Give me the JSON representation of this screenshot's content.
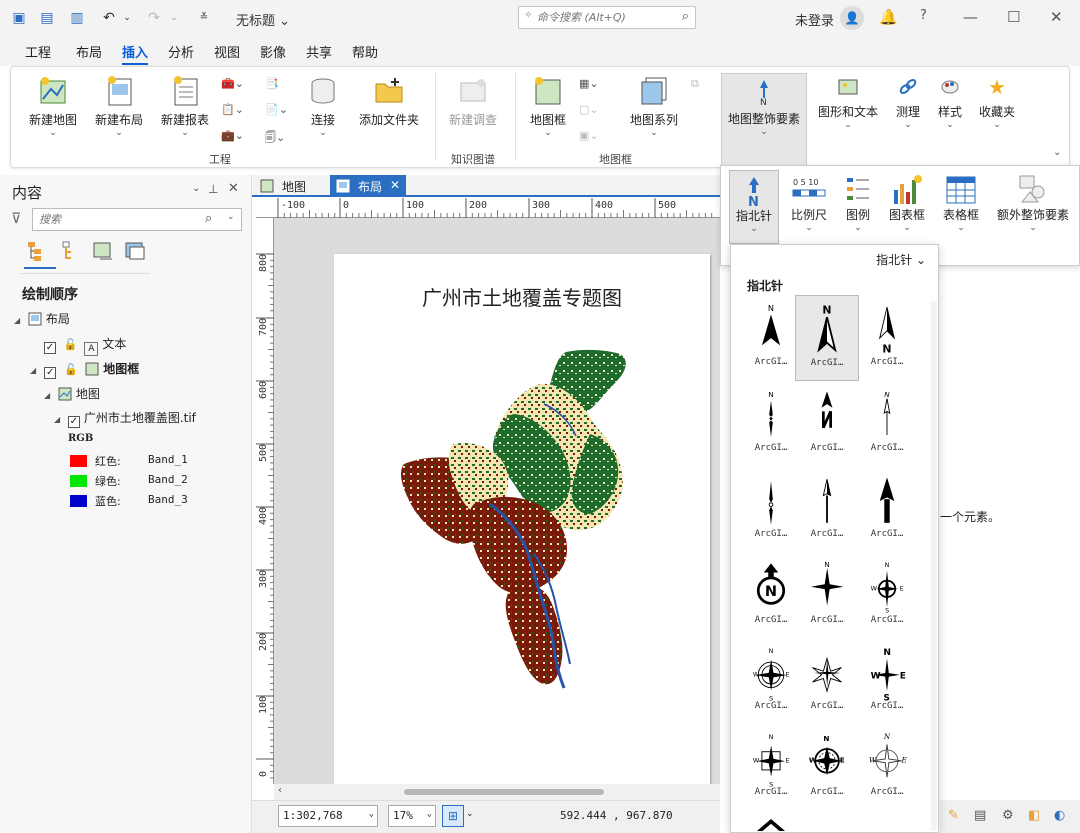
{
  "titlebar": {
    "doc_title": "无标题 ⌄",
    "search_placeholder": "命令搜索 (Alt+Q)",
    "login": "未登录"
  },
  "menu_tabs": [
    "工程",
    "布局",
    "插入",
    "分析",
    "视图",
    "影像",
    "共享",
    "帮助"
  ],
  "active_menu_tab": "插入",
  "ribbon": {
    "buttons": {
      "new_map": "新建地图",
      "new_layout": "新建布局",
      "new_report": "新建报表",
      "connect": "连接",
      "add_folder": "添加文件夹",
      "new_survey": "新建调查",
      "map_frame": "地图框",
      "map_series": "地图系列",
      "decor": "地图整饰要素",
      "graphics_text": "图形和文本",
      "measure": "测理",
      "style": "样式",
      "favorites": "收藏夹"
    },
    "groups": {
      "project": "工程",
      "knowledge": "知识图谱",
      "mapframe": "地图框"
    }
  },
  "contents": {
    "title": "内容",
    "search_placeholder": "搜索",
    "draw_order": "绘制顺序",
    "tree": {
      "layout": "布局",
      "text": "文本",
      "mapframe": "地图框",
      "map": "地图",
      "raster": "广州市土地覆盖图.tif",
      "rgb": "RGB"
    },
    "legend": [
      {
        "channel": "红色:",
        "band": "Band_1",
        "color": "#ff0000"
      },
      {
        "channel": "绿色:",
        "band": "Band_2",
        "color": "#00e600"
      },
      {
        "channel": "蓝色:",
        "band": "Band_3",
        "color": "#0000cc"
      }
    ]
  },
  "view_tabs": [
    "地图",
    "布局"
  ],
  "active_view_tab": "布局",
  "ruler": {
    "h_ticks": [
      "-100",
      "0",
      "100",
      "200",
      "300",
      "400",
      "500"
    ],
    "v_ticks": [
      "800",
      "700",
      "600",
      "500",
      "400",
      "300",
      "200",
      "100",
      "0"
    ]
  },
  "layout_page": {
    "map_title": "广州市土地覆盖专题图"
  },
  "statusbar": {
    "scale": "1:302,768",
    "zoom": "17%",
    "coords": "592.444 , 967.870"
  },
  "decor_menu": {
    "items": [
      "指北针",
      "比例尺",
      "图例",
      "图表框",
      "表格框",
      "额外整饰要素"
    ],
    "scale_glyph": "0 5 10"
  },
  "gallery": {
    "selector": "指北针 ⌄",
    "heading": "指北针",
    "item_label": "ArcGI…",
    "selected_index": 1,
    "count": 18
  },
  "hint_text": "一个元素。",
  "colors": {
    "accent": "#2a6fc2",
    "forest": "#1e6b2e",
    "farmland": "#f4e6b0",
    "builtup": "#7a1a0a",
    "water": "#2453a8"
  }
}
